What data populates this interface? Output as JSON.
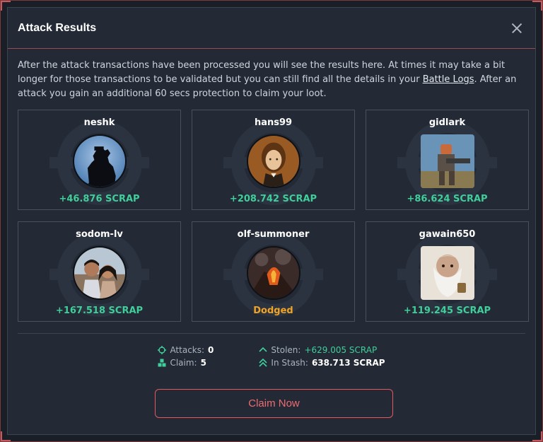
{
  "modal": {
    "title": "Attack Results",
    "description_pre": "After the attack transactions have been processed you will see the results here. At times it may take a bit longer for those transactions to be validated but you can still find all the details in your ",
    "description_link": "Battle Logs",
    "description_post": ". After an attack you gain an additional 60 secs protection to claim your loot."
  },
  "results": [
    {
      "username": "neshk",
      "result": "+46.876 SCRAP",
      "status": "win",
      "avatar": "silhouette-avatar"
    },
    {
      "username": "hans99",
      "result": "+208.742 SCRAP",
      "status": "win",
      "avatar": "portrait-avatar"
    },
    {
      "username": "gidlark",
      "result": "+86.624 SCRAP",
      "status": "win",
      "avatar": "robot-soldier-avatar"
    },
    {
      "username": "sodom-lv",
      "result": "+167.518 SCRAP",
      "status": "win",
      "avatar": "couple-photo-avatar"
    },
    {
      "username": "olf-summoner",
      "result": "Dodged",
      "status": "dodged",
      "avatar": "volcano-avatar"
    },
    {
      "username": "gawain650",
      "result": "+119.245 SCRAP",
      "status": "win",
      "avatar": "old-dwarf-avatar"
    }
  ],
  "stats": {
    "attacks_label": "Attacks:",
    "attacks_value": "0",
    "claim_label": "Claim:",
    "claim_value": "5",
    "stolen_label": "Stolen:",
    "stolen_value": "+629.005 SCRAP",
    "stash_label": "In Stash:",
    "stash_value": "638.713 SCRAP"
  },
  "claim_button": "Claim Now",
  "colors": {
    "accent": "#e2585e",
    "win": "#3fcf9a",
    "dodged": "#f0a425",
    "panel": "#232a35"
  }
}
